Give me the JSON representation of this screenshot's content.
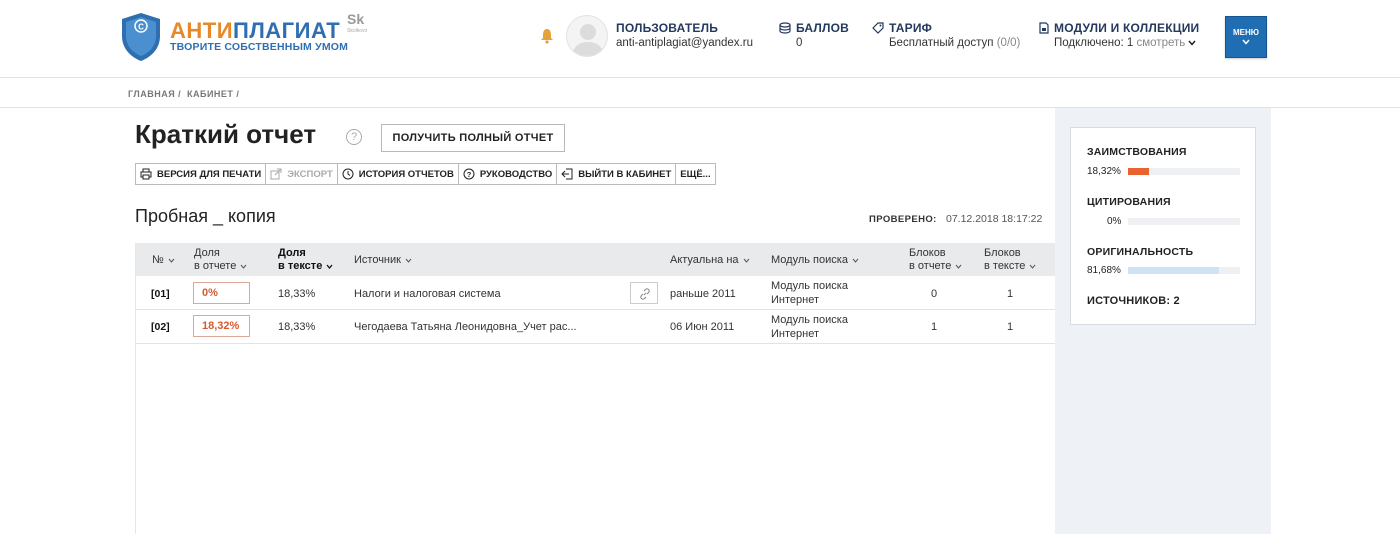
{
  "header": {
    "logo_part1": "АНТИ",
    "logo_part2": "ПЛАГИАТ",
    "logo_tagline": "ТВОРИТЕ СОБСТВЕННЫМ УМОМ",
    "partner_mark": "Sk",
    "partner_name": "Skolkovo",
    "user_label": "ПОЛЬЗОВАТЕЛЬ",
    "user_email": "anti-antiplagiat@yandex.ru",
    "points_label": "БАЛЛОВ",
    "points_value": "0",
    "tariff_label": "ТАРИФ",
    "tariff_value": "Бесплатный доступ",
    "tariff_quota": "(0/0)",
    "modules_label": "МОДУЛИ И КОЛЛЕКЦИИ",
    "modules_connected": "Подключено: 1",
    "modules_view": "смотреть",
    "menu_label": "МЕНЮ"
  },
  "breadcrumb": {
    "home": "ГЛАВНАЯ /",
    "cabinet": "КАБИНЕТ /"
  },
  "report": {
    "title": "Краткий отчет",
    "help_glyph": "?",
    "full_report_button": "ПОЛУЧИТЬ ПОЛНЫЙ ОТЧЕТ",
    "doc_name": "Пробная _ копия",
    "checked_label": "ПРОВЕРЕНО:",
    "checked_value": "07.12.2018 18:17:22"
  },
  "toolbar": {
    "print": "ВЕРСИЯ ДЛЯ ПЕЧАТИ",
    "export": "ЭКСПОРТ",
    "history": "ИСТОРИЯ ОТЧЕТОВ",
    "guide": "РУКОВОДСТВО",
    "exit": "ВЫЙТИ В КАБИНЕТ",
    "more": "ЕЩЁ..."
  },
  "table": {
    "headers": {
      "num": "№",
      "share_report_1": "Доля",
      "share_report_2": "в отчете",
      "share_text_1": "Доля",
      "share_text_2": "в тексте",
      "source": "Источник",
      "actual": "Актуальна на",
      "module": "Модуль поиска",
      "blocks_report_1": "Блоков",
      "blocks_report_2": "в отчете",
      "blocks_text_1": "Блоков",
      "blocks_text_2": "в тексте"
    },
    "rows": [
      {
        "num": "[01]",
        "share_report": "0%",
        "share_text": "18,33%",
        "source": "Налоги и налоговая система",
        "actual": "раньше 2011",
        "module_1": "Модуль поиска",
        "module_2": "Интернет",
        "blocks_report": "0",
        "blocks_text": "1"
      },
      {
        "num": "[02]",
        "share_report": "18,32%",
        "share_text": "18,33%",
        "source": "Чегодаева Татьяна Леонидовна_Учет рас...",
        "actual": "06 Июн 2011",
        "module_1": "Модуль поиска",
        "module_2": "Интернет",
        "blocks_report": "1",
        "blocks_text": "1"
      }
    ]
  },
  "stats": {
    "borrowing_label": "ЗАИМСТВОВАНИЯ",
    "borrowing_value": "18,32%",
    "borrowing_fraction": 0.1832,
    "citation_label": "ЦИТИРОВАНИЯ",
    "citation_value": "0%",
    "citation_fraction": 0,
    "originality_label": "ОРИГИНАЛЬНОСТЬ",
    "originality_value": "81,68%",
    "originality_fraction": 0.8168,
    "sources_label": "ИСТОЧНИКОВ:",
    "sources_value": "2"
  },
  "colors": {
    "brand_orange": "#e5892a",
    "brand_blue": "#2f6fb1",
    "borrowing_bar": "#e8632e",
    "originality_bar": "#cfe3f5",
    "menu_button": "#1f6db3"
  }
}
